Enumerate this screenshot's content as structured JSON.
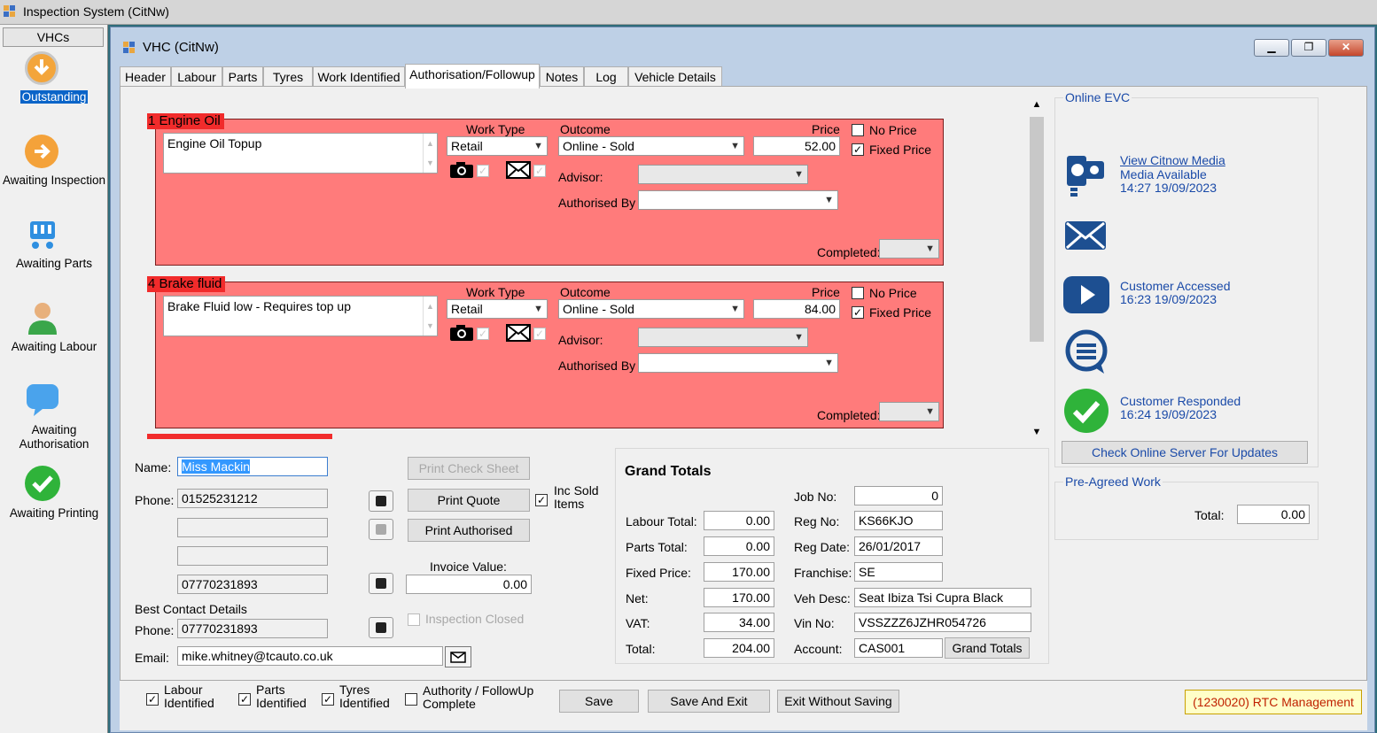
{
  "app": {
    "title": "Inspection System (CitNw)"
  },
  "sidebar": {
    "header": "VHCs",
    "items": [
      {
        "label": "Outstanding",
        "icon": "download-arrow-icon"
      },
      {
        "label": "Awaiting Inspection",
        "icon": "arrow-right-icon"
      },
      {
        "label": "Awaiting Parts",
        "icon": "cart-icon"
      },
      {
        "label": "Awaiting Labour",
        "icon": "user-icon"
      },
      {
        "label": "Awaiting Authorisation",
        "icon": "speech-bubble-icon"
      },
      {
        "label": "Awaiting Printing",
        "icon": "checkmark-icon"
      }
    ]
  },
  "window": {
    "title": "VHC (CitNw)"
  },
  "tabs": [
    "Header",
    "Labour",
    "Parts",
    "Tyres",
    "Work Identified",
    "Authorisation/Followup",
    "Notes",
    "Log",
    "Vehicle Details"
  ],
  "labels": {
    "work_type": "Work Type",
    "outcome": "Outcome",
    "price": "Price",
    "no_price": "No Price",
    "fixed_price": "Fixed Price",
    "advisor": "Advisor:",
    "authorised_by": "Authorised By",
    "completed": "Completed:"
  },
  "items": [
    {
      "title": "1 Engine Oil",
      "description": "Engine Oil Topup",
      "work_type": "Retail",
      "outcome": "Online - Sold",
      "price": "52.00",
      "fixed_price_checked": true
    },
    {
      "title": "4 Brake fluid",
      "description": "Brake Fluid low -  Requires top up",
      "work_type": "Retail",
      "outcome": "Online - Sold",
      "price": "84.00",
      "fixed_price_checked": true
    }
  ],
  "contact": {
    "name_label": "Name:",
    "name": "Miss Mackin",
    "phone_label": "Phone:",
    "phone1": "01525231212",
    "phone2": "",
    "phone3": "",
    "phone4": "07770231893",
    "best_contact_label": "Best Contact Details",
    "best_phone_label": "Phone:",
    "best_phone": "07770231893",
    "email_label": "Email:",
    "email": "mike.whitney@tcauto.co.uk"
  },
  "actions": {
    "print_check_sheet": "Print Check Sheet",
    "print_quote": "Print Quote",
    "inc_sold_items": "Inc Sold Items",
    "print_authorised": "Print Authorised",
    "invoice_value_label": "Invoice Value:",
    "invoice_value": "0.00",
    "inspection_closed": "Inspection Closed"
  },
  "grand_totals": {
    "heading": "Grand Totals",
    "labour_total_label": "Labour Total:",
    "labour_total": "0.00",
    "parts_total_label": "Parts Total:",
    "parts_total": "0.00",
    "fixed_price_label": "Fixed Price:",
    "fixed_price": "170.00",
    "net_label": "Net:",
    "net": "170.00",
    "vat_label": "VAT:",
    "vat": "34.00",
    "total_label": "Total:",
    "total": "204.00",
    "job_no_label": "Job No:",
    "job_no": "0",
    "reg_no_label": "Reg No:",
    "reg_no": "KS66KJO",
    "reg_date_label": "Reg Date:",
    "reg_date": "26/01/2017",
    "franchise_label": "Franchise:",
    "franchise": "SE",
    "veh_desc_label": "Veh Desc:",
    "veh_desc": "Seat Ibiza Tsi Cupra Black",
    "vin_no_label": "Vin No:",
    "vin_no": "VSSZZZ6JZHR054726",
    "account_label": "Account:",
    "account": "CAS001",
    "grand_totals_button": "Grand Totals"
  },
  "online_evc": {
    "title": "Online EVC",
    "view_media": "View Citnow Media",
    "media_available": "Media Available",
    "media_time": "14:27 19/09/2023",
    "customer_accessed": "Customer Accessed",
    "accessed_time": "16:23 19/09/2023",
    "customer_responded": "Customer Responded",
    "responded_time": "16:24 19/09/2023",
    "check_button": "Check Online Server For Updates"
  },
  "pre_agreed": {
    "title": "Pre-Agreed Work",
    "total_label": "Total:",
    "total": "0.00"
  },
  "bottom": {
    "labour_identified": "Labour Identified",
    "parts_identified": "Parts Identified",
    "tyres_identified": "Tyres Identified",
    "authority_complete": "Authority / FollowUp Complete",
    "save": "Save",
    "save_and_exit": "Save And Exit",
    "exit_without_saving": "Exit Without Saving",
    "status": "(1230020) RTC Management"
  },
  "colors": {
    "card_bg": "#ff7b7b",
    "card_title": "#f12b2b",
    "selection": "#0a64c8",
    "link": "#1a4aa8",
    "evc_icon": "#1d4f91",
    "status_bg": "#ffffc8"
  }
}
